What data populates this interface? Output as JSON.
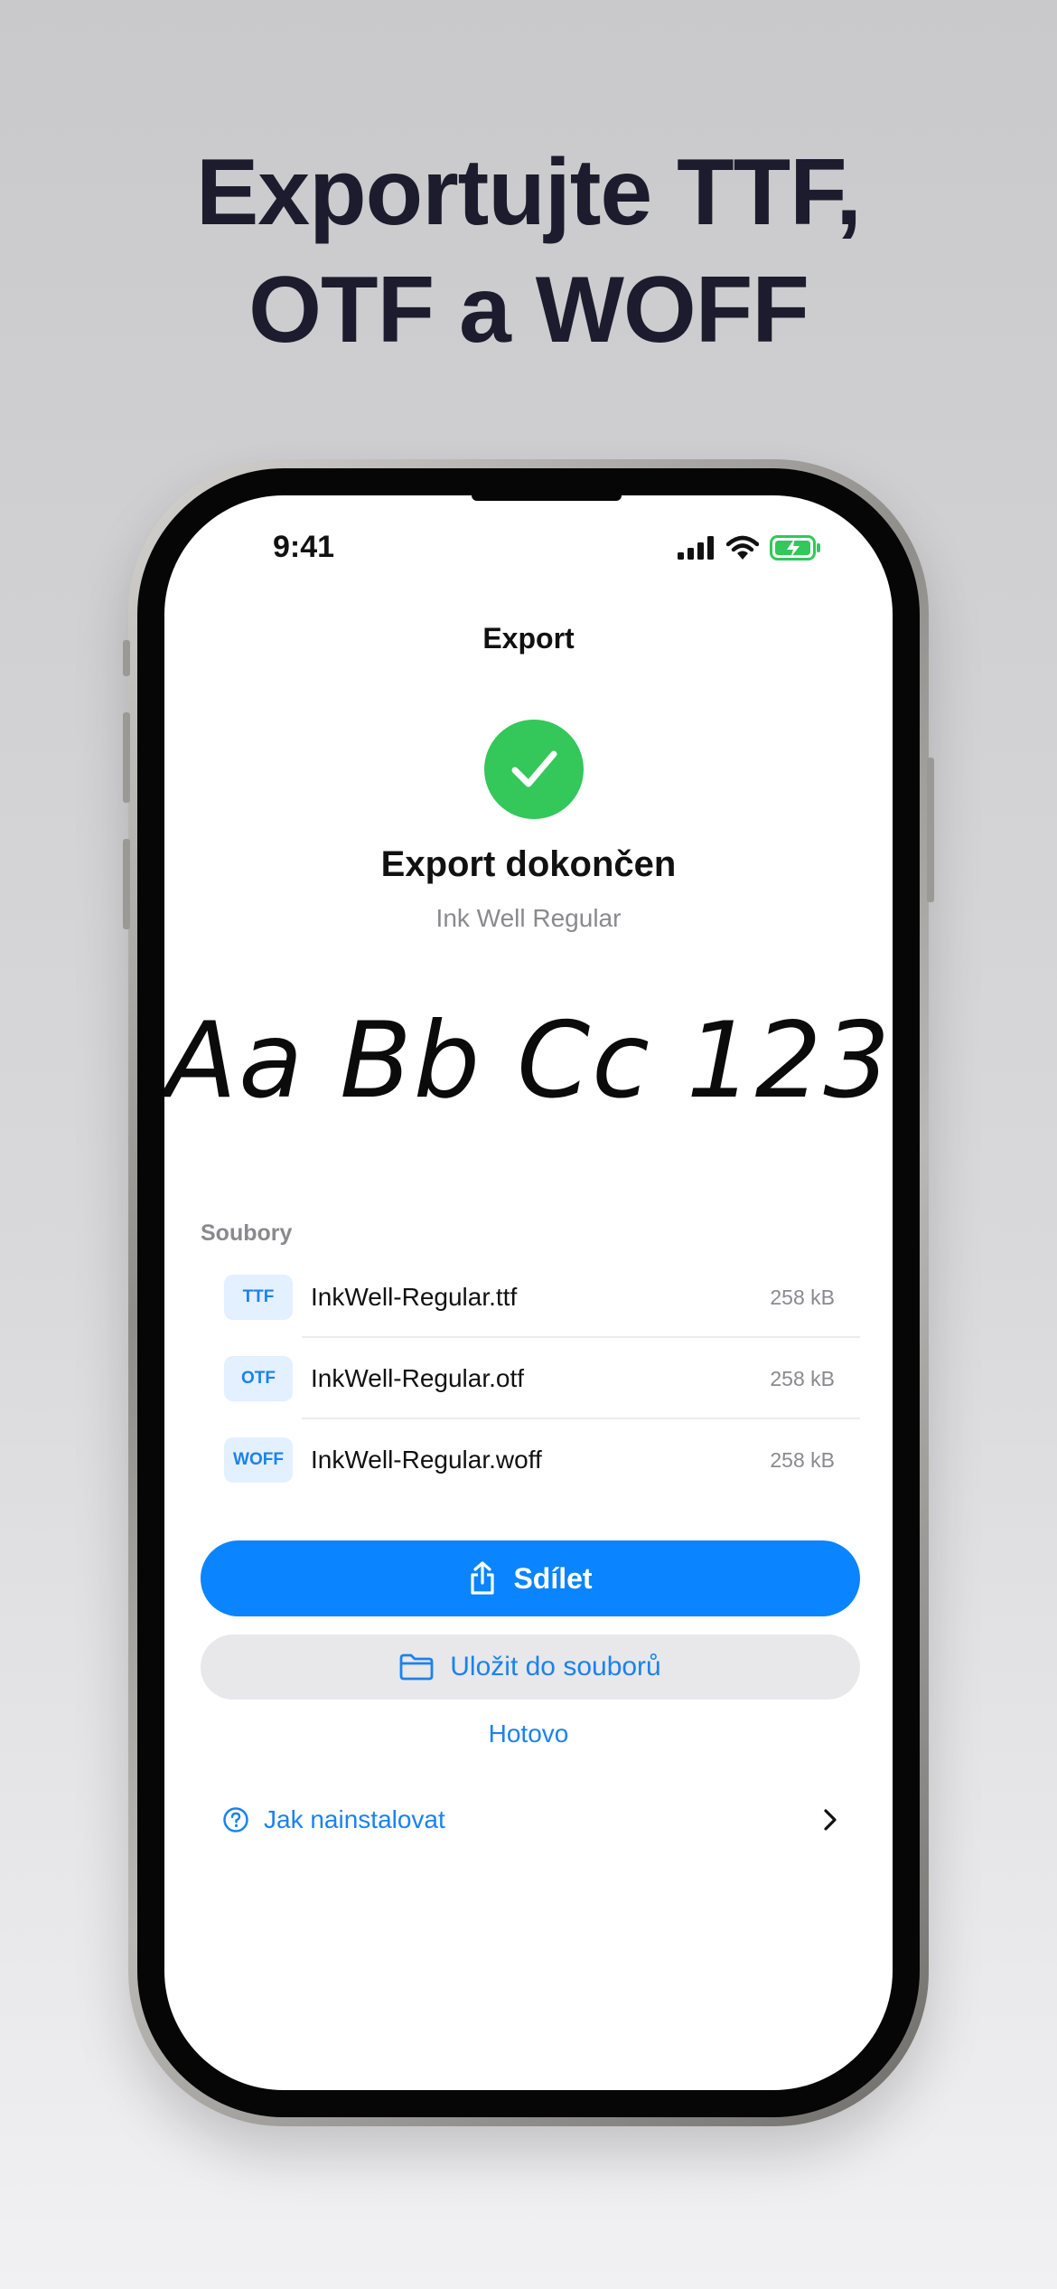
{
  "headline": {
    "line1": "Exportujte TTF,",
    "line2": "OTF a WOFF"
  },
  "status_bar": {
    "time": "9:41"
  },
  "nav": {
    "title": "Export"
  },
  "success": {
    "icon": "checkmark-icon",
    "title": "Export dokončen",
    "font_name": "Ink Well Regular",
    "color": "#34c759"
  },
  "preview": {
    "text": "Aa Bb Cc 123"
  },
  "files": {
    "section_label": "Soubory",
    "items": [
      {
        "badge": "TTF",
        "name": "InkWell-Regular.ttf",
        "size": "258 kB"
      },
      {
        "badge": "OTF",
        "name": "InkWell-Regular.otf",
        "size": "258 kB"
      },
      {
        "badge": "WOFF",
        "name": "InkWell-Regular.woff",
        "size": "258 kB"
      }
    ]
  },
  "actions": {
    "share_label": "Sdílet",
    "save_label": "Uložit do souborů",
    "done_label": "Hotovo",
    "accent": "#0a84ff"
  },
  "help": {
    "install_label": "Jak nainstalovat",
    "icon": "question-circle-icon"
  }
}
